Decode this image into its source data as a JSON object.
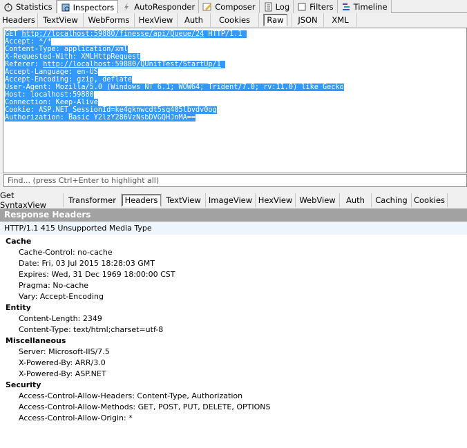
{
  "main_tabs": [
    {
      "label": "Statistics",
      "icon": "stopwatch-icon"
    },
    {
      "label": "Inspectors",
      "icon": "inspect-icon",
      "active": true
    },
    {
      "label": "AutoResponder",
      "icon": "lightning-icon"
    },
    {
      "label": "Composer",
      "icon": "pencil-icon"
    },
    {
      "label": "Log",
      "icon": "document-icon"
    },
    {
      "label": "Filters",
      "icon": "checkbox-icon"
    },
    {
      "label": "Timeline",
      "icon": "timeline-icon"
    }
  ],
  "request_tabs": [
    "Headers",
    "TextView",
    "WebForms",
    "HexView",
    "Auth",
    "Cookies",
    "Raw",
    "JSON",
    "XML"
  ],
  "request_active": "Raw",
  "raw_request": {
    "method": "GET ",
    "url": "http://localhost:59880/finesse/api/Queue/24",
    "proto": " HTTP/1.1",
    "lines": [
      "Accept: */*",
      "Content-Type: application/xml",
      "X-Requested-With: XMLHttpRequest"
    ],
    "referer_key": "Referer: ",
    "referer_url": "http://localhost:59880/QUnitTest/StartUp/1",
    "lines2": [
      "Accept-Language: en-US",
      "Accept-Encoding: gzip, deflate",
      "User-Agent: Mozilla/5.0 (Windows NT 6.1; WOW64; Trident/7.0; rv:11.0) like Gecko",
      "Host: localhost:59880",
      "Connection: Keep-Alive",
      "Cookie: ASP.NET_SessionId=ke4gknwcdt5sq405lbvdv0og",
      "Authorization: Basic Y2lzY286VzNsbDVGQHJnMA=="
    ]
  },
  "find_placeholder": "Find... (press Ctrl+Enter to highlight all)",
  "response_tabs": [
    "Get SyntaxView",
    "Transformer",
    "Headers",
    "TextView",
    "ImageView",
    "HexView",
    "WebView",
    "Auth",
    "Caching",
    "Cookies"
  ],
  "response_active": "Headers",
  "response_title": "Response Headers",
  "status_line": "HTTP/1.1 415 Unsupported Media Type",
  "groups": [
    {
      "name": "Cache",
      "items": [
        "Cache-Control: no-cache",
        "Date: Fri, 03 Jul 2015 18:28:03 GMT",
        "Expires: Wed, 31 Dec 1969 18:00:00 CST",
        "Pragma: No-cache",
        "Vary: Accept-Encoding"
      ]
    },
    {
      "name": "Entity",
      "items": [
        "Content-Length: 2349",
        "Content-Type: text/html;charset=utf-8"
      ]
    },
    {
      "name": "Miscellaneous",
      "items": [
        "Server: Microsoft-IIS/7.5",
        "X-Powered-By: ARR/3.0",
        "X-Powered-By: ASP.NET"
      ]
    },
    {
      "name": "Security",
      "items": [
        "Access-Control-Allow-Headers: Content-Type, Authorization",
        "Access-Control-Allow-Methods: GET, POST, PUT, DELETE, OPTIONS",
        "Access-Control-Allow-Origin: *"
      ]
    }
  ],
  "colors": {
    "selection": "#3399ff",
    "header_bar": "#a2a2a2"
  }
}
